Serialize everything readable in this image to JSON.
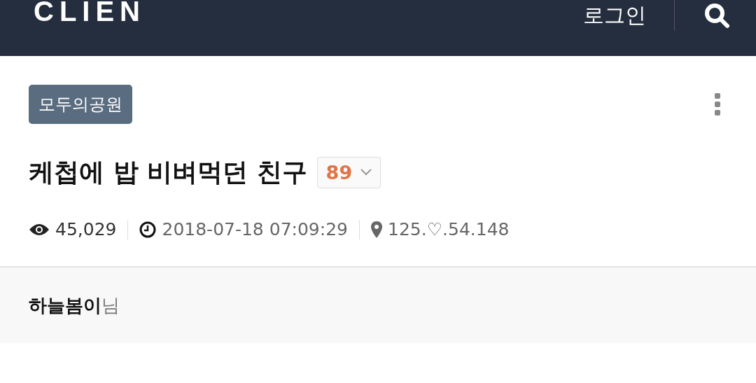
{
  "header": {
    "logo": "CLIEN",
    "login": "로그인"
  },
  "post": {
    "board": "모두의공원",
    "title": "케첩에 밥 비벼먹던 친구",
    "comment_count": "89",
    "views": "45,029",
    "date": "2018-07-18 07:09:29",
    "ip": "125.♡.54.148"
  },
  "author": {
    "name": "하늘봄이",
    "suffix": "님"
  }
}
